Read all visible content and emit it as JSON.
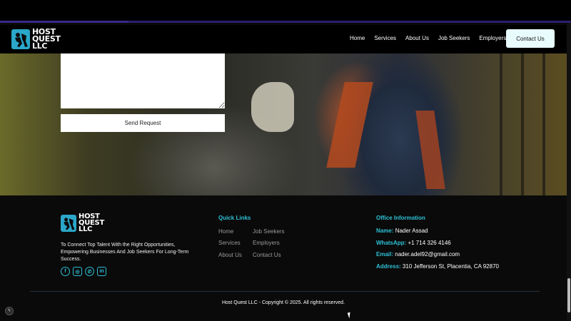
{
  "brand": {
    "logo_text_line1": "HOST",
    "logo_text_line2": "QUEST",
    "logo_text_line3": "LLC"
  },
  "nav": {
    "items": [
      {
        "label": "Home"
      },
      {
        "label": "Services"
      },
      {
        "label": "About Us"
      },
      {
        "label": "Job Seekers"
      },
      {
        "label": "Employers"
      }
    ],
    "cta_label": "Contact Us"
  },
  "form": {
    "message_value": "",
    "submit_label": "Send Request"
  },
  "footer": {
    "description": "To Connect Top Talent With the Right Opportunities, Empowering Businesses And Job Seekers For Long-Term Success.",
    "social_icons": [
      "facebook-icon",
      "instagram-icon",
      "whatsapp-icon",
      "linkedin-icon"
    ],
    "quick_links": {
      "title": "Quick Links",
      "col1": [
        "Home",
        "Services",
        "About Us"
      ],
      "col2": [
        "Job Seekers",
        "Employers",
        "Contact Us"
      ]
    },
    "office": {
      "title": "Office Information",
      "name_key": "Name:",
      "name_val": "Nader Assad",
      "whatsapp_key": "WhatsApp:",
      "whatsapp_val": "+1 714 326 4146",
      "email_key": "Email:",
      "email_val": "nader.adel92@gmail.com",
      "address_key": "Address:",
      "address_val": "310 Jefferson St, Placentia, CA 92870"
    },
    "copyright": "Host Quest LLC - Copyright © 2025. All rights reserved."
  },
  "colors": {
    "accent": "#2ec0d6",
    "cta_bg": "#e8fbfd",
    "background": "#0a0a0a"
  }
}
